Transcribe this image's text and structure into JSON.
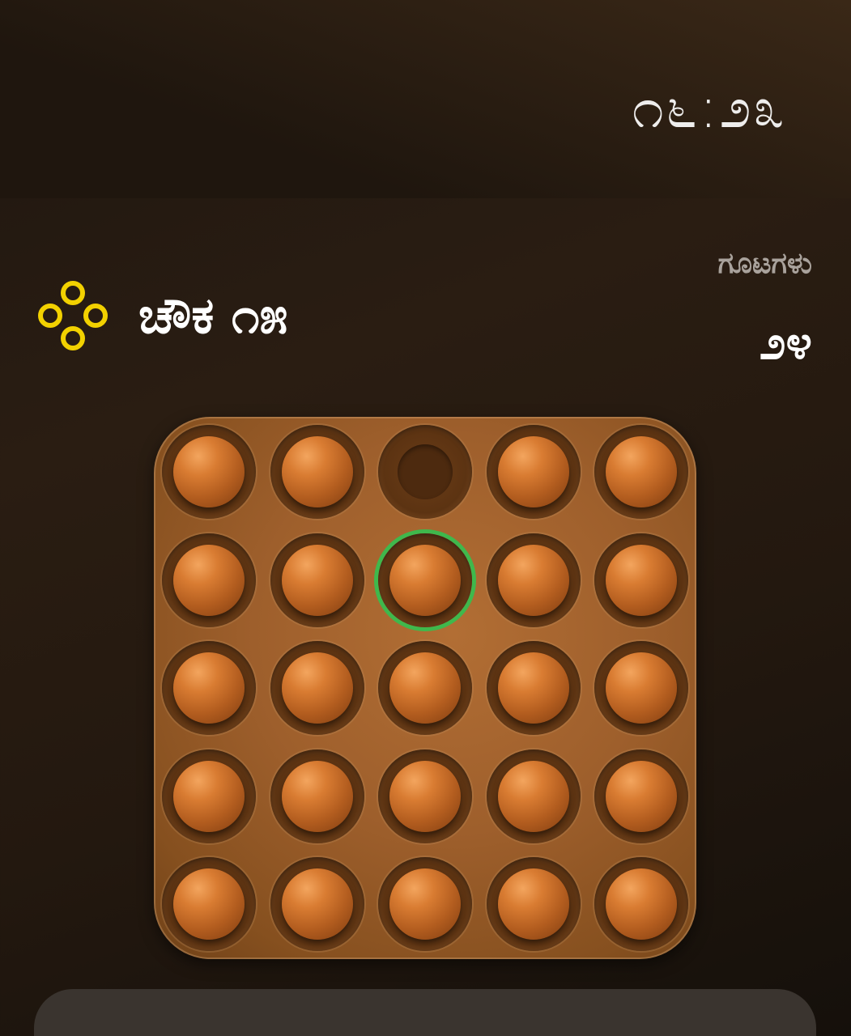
{
  "header": {
    "clock": "೧೬:೨೩"
  },
  "level": {
    "title": "ಚೌಕ ೧೫",
    "icon": "four-rings-icon",
    "icon_color": "#f2d100"
  },
  "stats": {
    "pegs_label": "ಗೂಟಗಳು",
    "pegs_count": "೨೪"
  },
  "board": {
    "rows": 5,
    "cols": 5,
    "cells": [
      [
        "peg",
        "peg",
        "empty",
        "peg",
        "peg"
      ],
      [
        "peg",
        "peg",
        "peg",
        "peg",
        "peg"
      ],
      [
        "peg",
        "peg",
        "peg",
        "peg",
        "peg"
      ],
      [
        "peg",
        "peg",
        "peg",
        "peg",
        "peg"
      ],
      [
        "peg",
        "peg",
        "peg",
        "peg",
        "peg"
      ]
    ],
    "selected": {
      "row": 1,
      "col": 2
    },
    "selection_color": "#3fb84c",
    "peg_color": "#d97c32",
    "board_color": "#9e5f2c"
  }
}
